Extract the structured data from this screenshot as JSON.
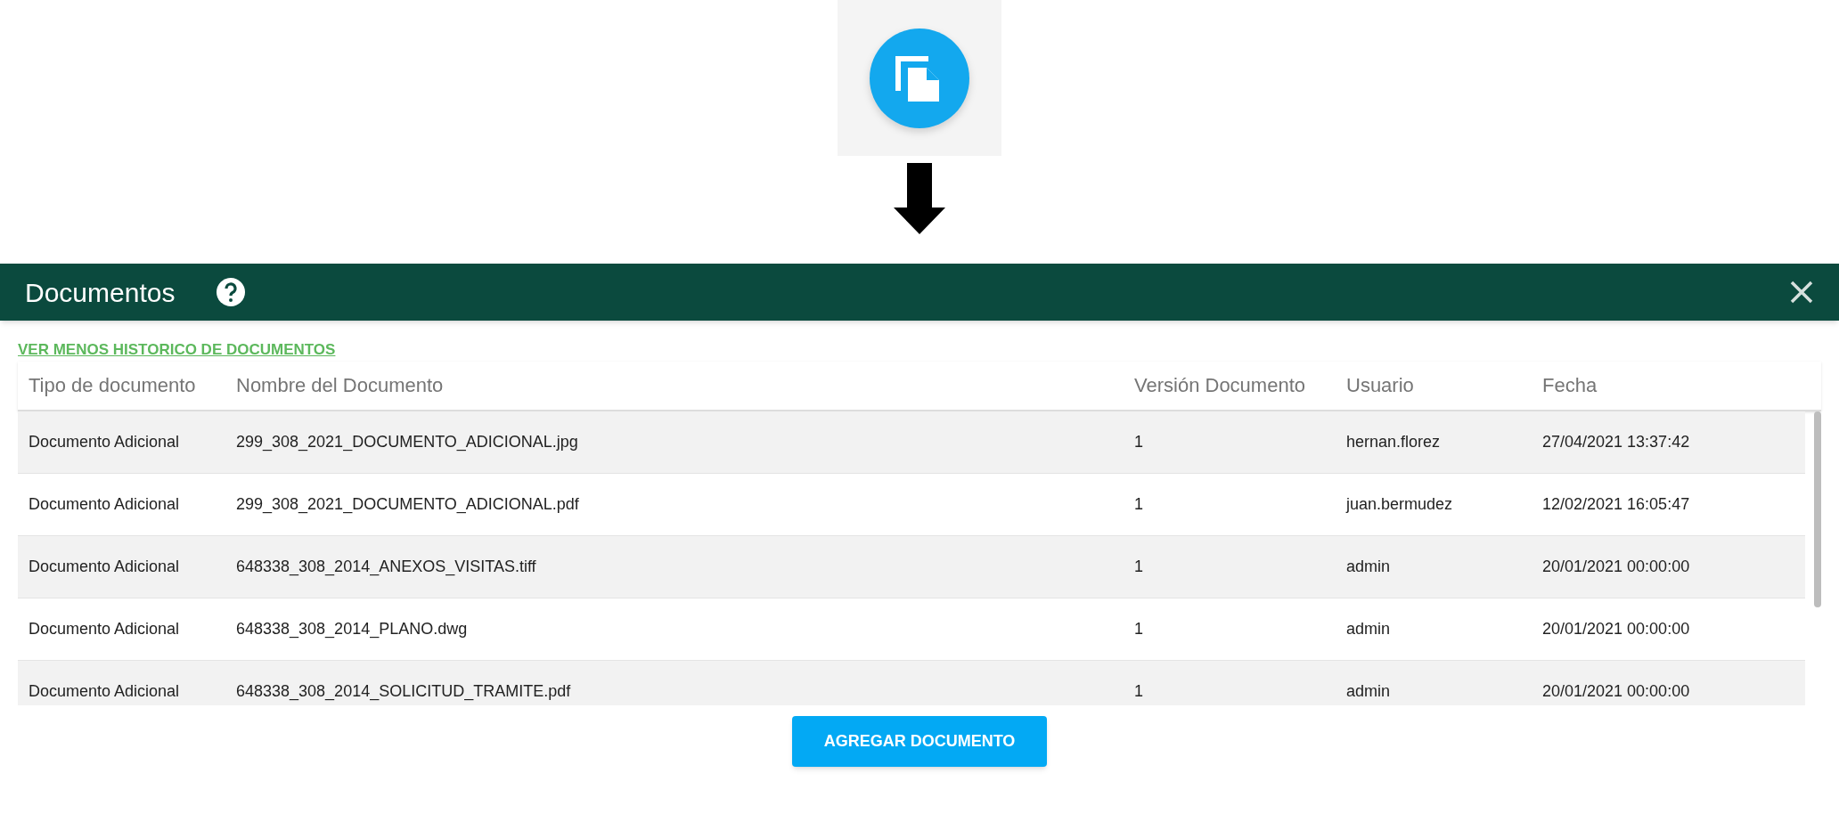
{
  "dialog": {
    "title": "Documentos",
    "toggle_link": "VER MENOS HISTORICO DE DOCUMENTOS",
    "button": "AGREGAR DOCUMENTO"
  },
  "table": {
    "columns": [
      "Tipo de documento",
      "Nombre del Documento",
      "Versión Documento",
      "Usuario",
      "Fecha"
    ],
    "rows": [
      [
        "Documento Adicional",
        "299_308_2021_DOCUMENTO_ADICIONAL.jpg",
        "1",
        "hernan.florez",
        "27/04/2021 13:37:42"
      ],
      [
        "Documento Adicional",
        "299_308_2021_DOCUMENTO_ADICIONAL.pdf",
        "1",
        "juan.bermudez",
        "12/02/2021 16:05:47"
      ],
      [
        "Documento Adicional",
        "648338_308_2014_ANEXOS_VISITAS.tiff",
        "1",
        "admin",
        "20/01/2021 00:00:00"
      ],
      [
        "Documento Adicional",
        "648338_308_2014_PLANO.dwg",
        "1",
        "admin",
        "20/01/2021 00:00:00"
      ],
      [
        "Documento Adicional",
        "648338_308_2014_SOLICITUD_TRAMITE.pdf",
        "1",
        "admin",
        "20/01/2021 00:00:00"
      ]
    ]
  }
}
